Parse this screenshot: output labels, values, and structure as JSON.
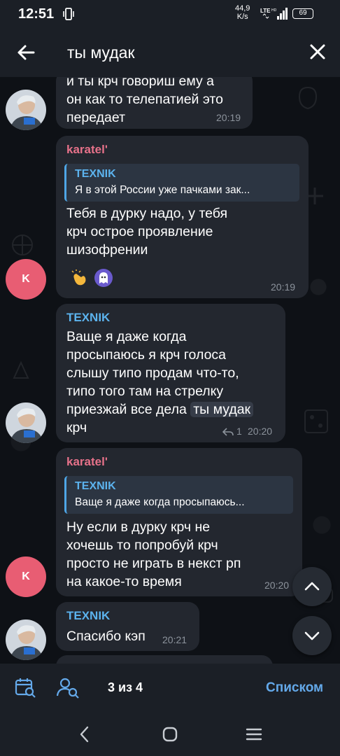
{
  "status_bar": {
    "time": "12:51",
    "speed_value": "44,9",
    "speed_unit": "K/s",
    "network": "LTE HD",
    "battery": "69"
  },
  "search": {
    "query": "ты мудак"
  },
  "messages": [
    {
      "sender": "",
      "text": "и ты крч говориш ему а он как то телепатией это передает",
      "lines": [
        "и ты крч говориш ему а",
        "он как то телепатией это",
        "передает"
      ],
      "time": "20:19"
    },
    {
      "sender": "karatel'",
      "avatar_letter": "K",
      "reply_to": {
        "author": "TEXNIK",
        "text": "Я в этой России уже пачками зак..."
      },
      "lines": [
        "Тебя в дурку надо, у тебя",
        "крч острое проявление",
        "шизофрении"
      ],
      "reactions": [
        "clap-emoji",
        "ghost-emoji"
      ],
      "time": "20:19"
    },
    {
      "sender": "TEXNIK",
      "lines": [
        "Ваще я даже когда",
        "просыпаюсь я крч голоса",
        "слышу типо продам что-то,",
        "типо того там на стрелку"
      ],
      "line5_before": "приезжай все дела ",
      "highlight": "ты мудак",
      "line6": "крч",
      "reply_count": "1",
      "time": "20:20"
    },
    {
      "sender": "karatel'",
      "avatar_letter": "K",
      "reply_to": {
        "author": "TEXNIK",
        "text": "Ваще я даже когда просыпаюсь..."
      },
      "lines": [
        "Ну если в дурку крч не",
        "хочешь то попробуй крч",
        "просто не играть в некст рп",
        "на какое-то время"
      ],
      "time": "20:20"
    },
    {
      "sender": "TEXNIK",
      "text": "Спасибо кэп",
      "time": "20:21"
    }
  ],
  "bottom_bar": {
    "counter": "3 из 4",
    "list_label": "Списком"
  },
  "colors": {
    "background": "#0e1116",
    "bubble": "#23272f",
    "karatel_name": "#e7728a",
    "texnik_name": "#5cb3ee",
    "accent": "#64a9ea",
    "avatar_k": "#e85d73"
  }
}
